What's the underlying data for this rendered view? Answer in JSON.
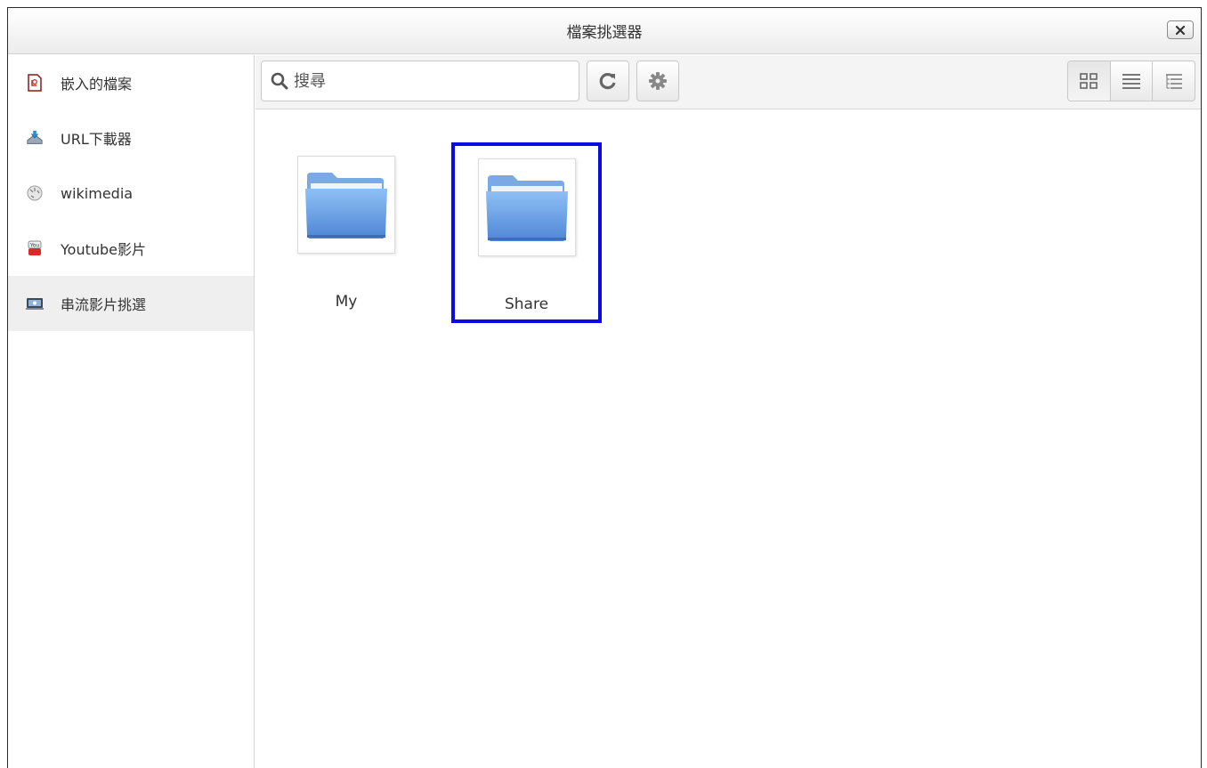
{
  "window": {
    "title": "檔案挑選器"
  },
  "sidebar": {
    "items": [
      {
        "label": "嵌入的檔案",
        "icon": "embedded-file-icon"
      },
      {
        "label": "URL下載器",
        "icon": "url-downloader-icon"
      },
      {
        "label": "wikimedia",
        "icon": "wikimedia-icon"
      },
      {
        "label": "Youtube影片",
        "icon": "youtube-icon"
      },
      {
        "label": "串流影片挑選",
        "icon": "streaming-video-icon",
        "active": true
      }
    ]
  },
  "toolbar": {
    "search": {
      "placeholder": "搜尋",
      "value": ""
    },
    "refresh_icon": "refresh-icon",
    "settings_icon": "gear-icon",
    "views": [
      "grid-view-icon",
      "list-view-icon",
      "tree-view-icon"
    ]
  },
  "files": [
    {
      "name": "My",
      "icon": "folder-icon",
      "selected": false
    },
    {
      "name": "Share",
      "icon": "folder-icon",
      "selected": true
    }
  ],
  "colors": {
    "selection": "#0a0ae6",
    "folder": "#6fa2e8",
    "active_item": "#efefef"
  }
}
